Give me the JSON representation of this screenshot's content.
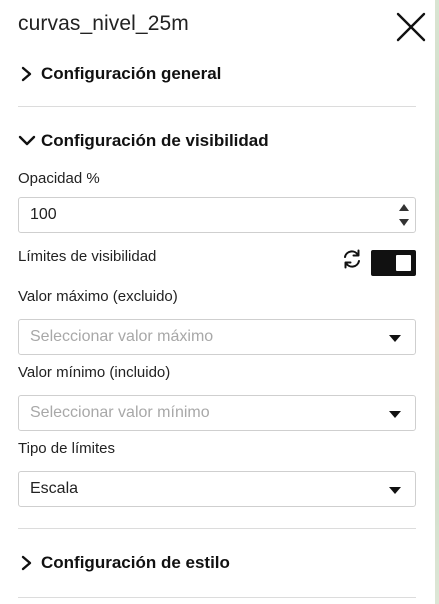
{
  "panel": {
    "title": "curvas_nivel_25m",
    "close_icon": "close-icon"
  },
  "sections": {
    "general": {
      "label": "Configuración general",
      "expanded": false
    },
    "visibility": {
      "label": "Configuración de visibilidad",
      "expanded": true
    },
    "style": {
      "label": "Configuración de estilo",
      "expanded": false
    }
  },
  "opacity": {
    "label": "Opacidad %",
    "value": "100"
  },
  "visibility_limits": {
    "label": "Límites de visibilidad",
    "toggle_on": true,
    "refresh_icon": "refresh-icon"
  },
  "max_value": {
    "label": "Valor máximo (excluido)",
    "placeholder": "Seleccionar valor máximo"
  },
  "min_value": {
    "label": "Valor mínimo (incluido)",
    "placeholder": "Seleccionar valor mínimo"
  },
  "limit_type": {
    "label": "Tipo de límites",
    "selected": "Escala"
  }
}
